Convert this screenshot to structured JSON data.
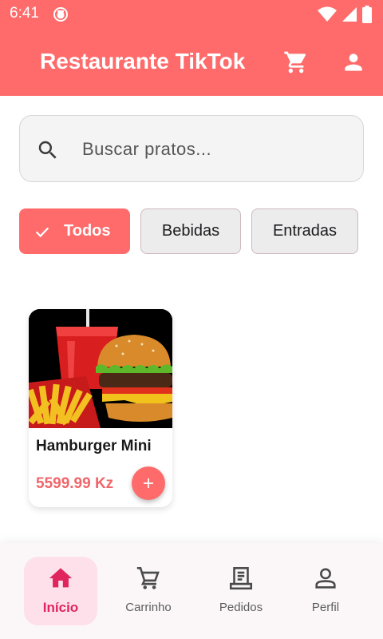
{
  "status_bar": {
    "time": "6:41"
  },
  "app_bar": {
    "title": "Restaurante TikTok",
    "actions": [
      "cart-icon",
      "person-icon"
    ]
  },
  "search": {
    "placeholder": "Buscar pratos...",
    "value": ""
  },
  "categories": [
    {
      "label": "Todos",
      "selected": true
    },
    {
      "label": "Bebidas",
      "selected": false
    },
    {
      "label": "Entradas",
      "selected": false
    }
  ],
  "products": [
    {
      "name": "Hamburger Mini",
      "price": "5599.99 Kz",
      "image": "burger-fries-soda"
    }
  ],
  "bottom_nav": [
    {
      "label": "Início",
      "icon": "home-icon",
      "active": true
    },
    {
      "label": "Carrinho",
      "icon": "cart-icon",
      "active": false
    },
    {
      "label": "Pedidos",
      "icon": "receipt-icon",
      "active": false
    },
    {
      "label": "Perfil",
      "icon": "person-icon",
      "active": false
    }
  ],
  "colors": {
    "primary": "#ff6b6b",
    "active_nav": "#e0245e",
    "active_nav_bg": "#fde0ea",
    "price": "#f0666a"
  }
}
